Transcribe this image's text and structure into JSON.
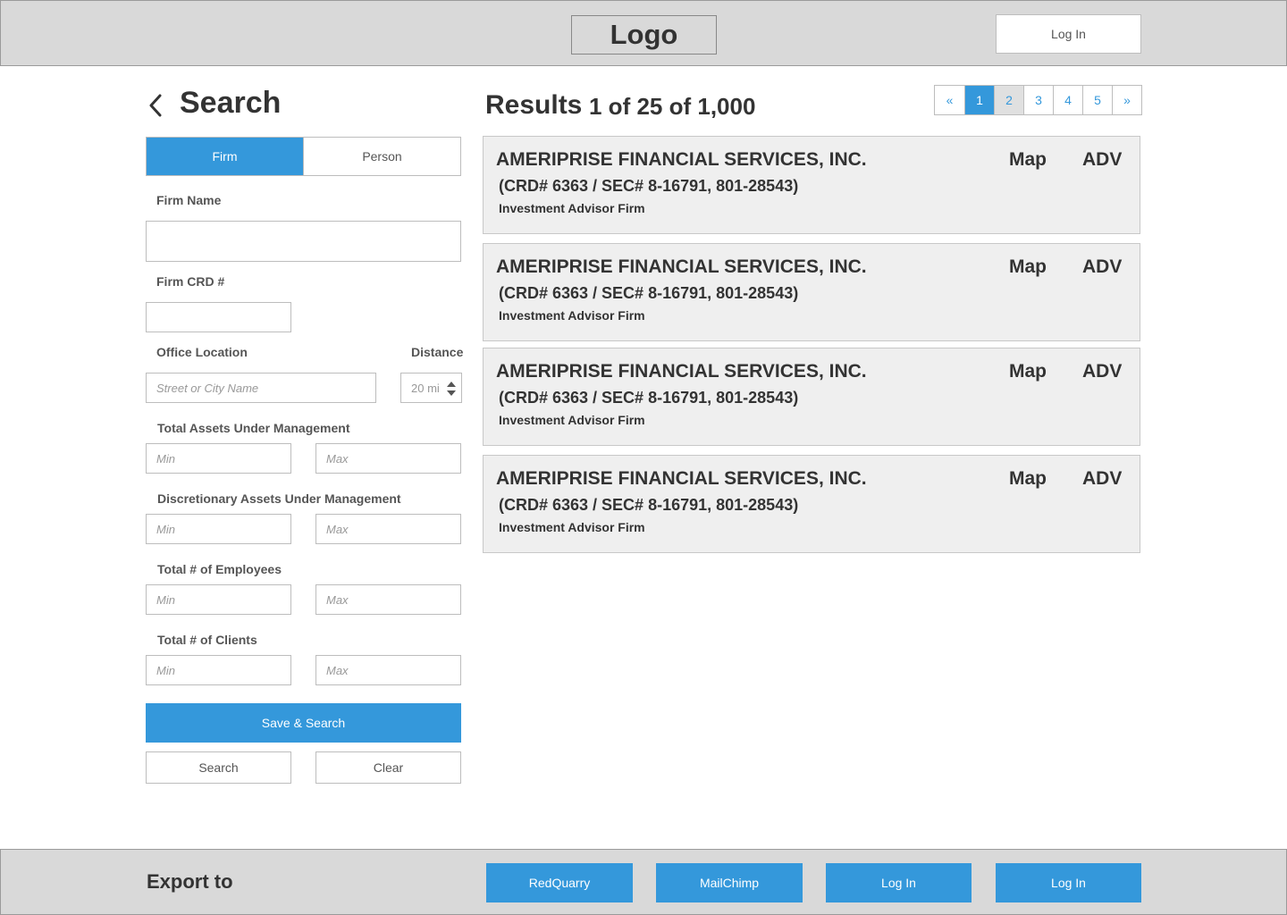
{
  "header": {
    "logo": "Logo",
    "login": "Log In"
  },
  "search": {
    "title": "Search",
    "tabs": [
      {
        "label": "Firm",
        "active": true
      },
      {
        "label": "Person",
        "active": false
      }
    ],
    "firm_name_label": "Firm Name",
    "firm_name_value": "",
    "firm_crd_label": "Firm CRD #",
    "firm_crd_value": "",
    "office_location_label": "Office Location",
    "office_location_placeholder": "Street or City Name",
    "distance_label": "Distance",
    "distance_value": "20 mi",
    "total_aum_label": "Total Assets Under Management",
    "discretionary_aum_label": "Discretionary Assets Under Management",
    "employees_label": "Total # of Employees",
    "clients_label": "Total # of Clients",
    "min_placeholder": "Min",
    "max_placeholder": "Max",
    "save_search": "Save & Search",
    "search_button": "Search",
    "clear_button": "Clear"
  },
  "results": {
    "title": "Results",
    "count": "1 of 25 of 1,000",
    "pagination": [
      "«",
      "1",
      "2",
      "3",
      "4",
      "5",
      "»"
    ],
    "current_page": "1",
    "items": [
      {
        "name": "AMERIPRISE FINANCIAL SERVICES, INC.",
        "ids": "(CRD# 6363 / SEC# 8-16791, 801-28543)",
        "type": "Investment Advisor Firm",
        "map": "Map",
        "adv": "ADV"
      },
      {
        "name": "AMERIPRISE FINANCIAL SERVICES, INC.",
        "ids": "(CRD# 6363 / SEC# 8-16791, 801-28543)",
        "type": "Investment Advisor Firm",
        "map": "Map",
        "adv": "ADV"
      },
      {
        "name": "AMERIPRISE FINANCIAL SERVICES, INC.",
        "ids": "(CRD# 6363 / SEC# 8-16791, 801-28543)",
        "type": "Investment Advisor Firm",
        "map": "Map",
        "adv": "ADV"
      },
      {
        "name": "AMERIPRISE FINANCIAL SERVICES, INC.",
        "ids": "(CRD# 6363 / SEC# 8-16791, 801-28543)",
        "type": "Investment Advisor Firm",
        "map": "Map",
        "adv": "ADV"
      }
    ]
  },
  "footer": {
    "export_label": "Export to",
    "buttons": [
      "RedQuarry",
      "MailChimp",
      "Log In",
      "Log In"
    ]
  },
  "colors": {
    "accent": "#3498db",
    "header_bg": "#d9d9d9",
    "card_bg": "#efefef"
  },
  "icons": {
    "back": "chevron-left-icon",
    "stepper": "stepper-arrows-icon"
  }
}
